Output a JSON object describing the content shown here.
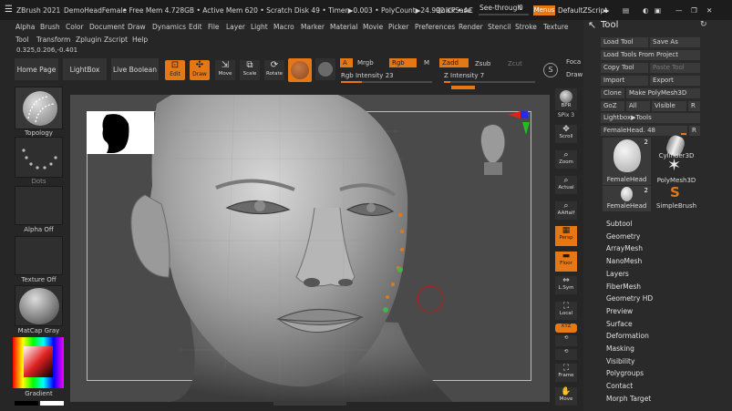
{
  "titlebar": {
    "app": "ZBrush 2021",
    "doc": "DemoHeadFemale",
    "stats": "..• Free Mem 4.728GB • Active Mem 620 • Scratch Disk 49 • Timer▶0.003 • PolyCount▶24.992 KP • AC",
    "quicksave": "QuickSave",
    "seethrough": "See-through",
    "seethrough_value": "0",
    "seethrough_fraction": 0.0,
    "menus": "Menus",
    "script": "DefaultZScript",
    "window_controls": [
      "◀▶",
      "—",
      "✕"
    ]
  },
  "menubar": [
    "Alpha",
    "Brush",
    "Color",
    "Document",
    "Draw",
    "Dynamics",
    "Edit",
    "File",
    "Layer",
    "Light",
    "Macro",
    "Marker",
    "Material",
    "Movie",
    "Picker",
    "Preferences",
    "Render",
    "Stencil",
    "Stroke",
    "Texture"
  ],
  "menubar2": [
    "Tool",
    "Transform",
    "Zplugin",
    "Zscript",
    "Help"
  ],
  "coords": "0.325,0.206,-0.401",
  "shelf": {
    "home": "Home Page",
    "lightbox": "LightBox",
    "live_boolean": "Live Boolean",
    "edit": "Edit",
    "draw": "Draw",
    "move": "Move",
    "scale": "Scale",
    "rotate": "Rotate",
    "a_chip": "A",
    "mrgb": "Mrgb",
    "rgb": "Rgb",
    "m": "M",
    "zadd": "Zadd",
    "zsub": "Zsub",
    "zcut": "Zcut",
    "rgb_intensity_label": "Rgb Intensity",
    "rgb_intensity_value": "23",
    "rgb_intensity_fraction": 0.23,
    "z_intensity_label": "Z Intensity",
    "z_intensity_value": "7",
    "z_intensity_fraction": 0.07,
    "focal": "Foca",
    "draw_size": "Draw"
  },
  "left_shelf": {
    "topology": "Topology",
    "dots": "Dots",
    "alpha_off": "Alpha Off",
    "texture_off": "Texture Off",
    "matcap": "MatCap Gray",
    "gradient": "Gradient"
  },
  "right_shelf": {
    "bpr": "BPR",
    "spix_label": "SPix",
    "spix_value": "3",
    "scroll": "Scroll",
    "zoom": "Zoom",
    "actual": "Actual",
    "aahalf": "AAHalf",
    "persp": "Persp",
    "floor": "Floor",
    "lsym": "L.Sym",
    "local": "Local",
    "xyz": "XYZ",
    "frame": "Frame",
    "move": "Move"
  },
  "tool_panel": {
    "title": "Tool",
    "load_tool": "Load Tool",
    "save_as": "Save As",
    "load_from_project": "Load Tools From Project",
    "copy_tool": "Copy Tool",
    "paste_tool": "Paste Tool",
    "import": "Import",
    "export": "Export",
    "clone": "Clone",
    "make_polymesh": "Make PolyMesh3D",
    "goz": "GoZ",
    "all": "All",
    "visible": "Visible",
    "r": "R",
    "lightbox_tools": "Lightbox▶Tools",
    "current_tool_label": "FemaleHead.",
    "current_tool_value": "48",
    "tools": [
      {
        "name": "FemaleHead",
        "count": "2"
      },
      {
        "name": "Cylinder3D",
        "count": ""
      },
      {
        "name": "PolyMesh3D",
        "count": ""
      },
      {
        "name": "FemaleHead",
        "count": "2"
      },
      {
        "name": "SimpleBrush",
        "count": ""
      }
    ],
    "subpalettes": [
      "Subtool",
      "Geometry",
      "ArrayMesh",
      "NanoMesh",
      "Layers",
      "FiberMesh",
      "Geometry HD",
      "Preview",
      "Surface",
      "Deformation",
      "Masking",
      "Visibility",
      "Polygroups",
      "Contact",
      "Morph Target"
    ]
  },
  "colors": {
    "accent": "#e57714",
    "panel": "#2a2a2a",
    "canvas": "#4a4a4a"
  }
}
